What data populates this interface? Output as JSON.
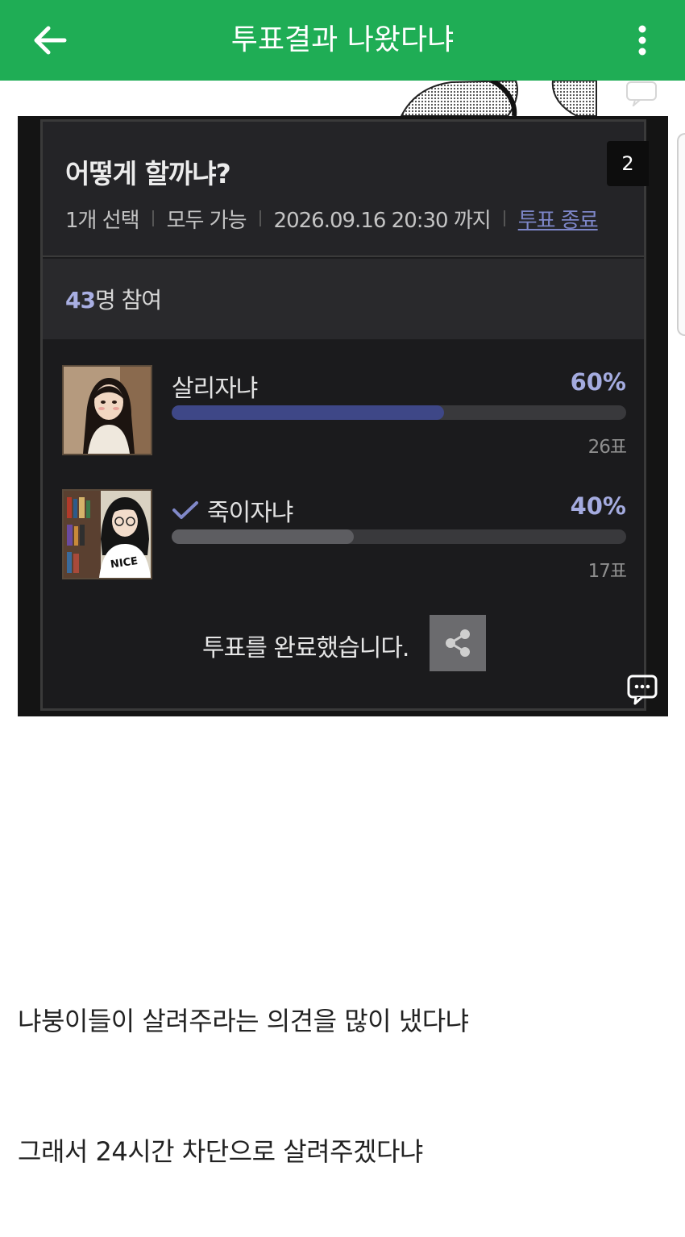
{
  "header": {
    "title": "투표결과 나왔다냐",
    "back_icon": "arrow-left-icon",
    "more_icon": "more-vertical-icon",
    "bg_color": "#1fad55"
  },
  "poll": {
    "question": "어떻게 할까냐?",
    "badge": "2",
    "meta": {
      "selection": "1개 선택",
      "audience": "모두 가능",
      "deadline": "2026.09.16 20:30 까지",
      "end_link": "투표 종료"
    },
    "participants": {
      "count": "43",
      "suffix": "명 참여"
    },
    "options": [
      {
        "label": "살리자냐",
        "percent_text": "60%",
        "percent": 60,
        "votes": "26표",
        "selected": false
      },
      {
        "label": "죽이자냐",
        "percent_text": "40%",
        "percent": 40,
        "votes": "17표",
        "selected": true
      }
    ],
    "done_text": "투표를 완료했습니다.",
    "share_icon": "share-icon",
    "comment_icon": "comment-icon",
    "accent_color": "#a4abdf"
  },
  "body": {
    "paragraphs": [
      "냐붕이들이 살려주라는 의견을 많이 냈다냐",
      "그래서 24시간 차단으로 살려주겠다냐"
    ]
  }
}
